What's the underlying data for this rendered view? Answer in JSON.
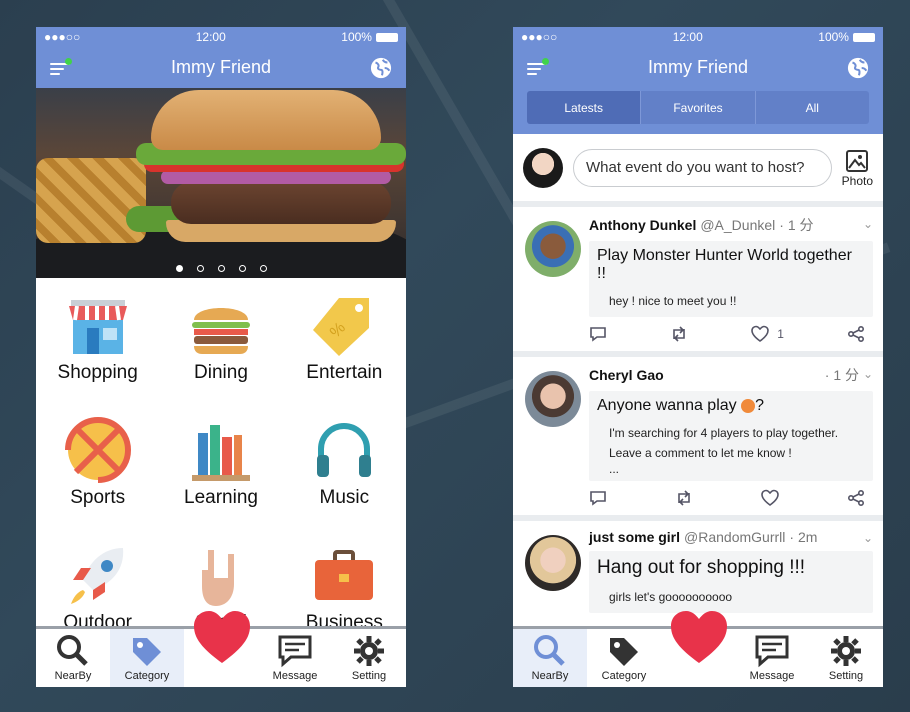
{
  "status": {
    "time": "12:00",
    "battery": "100%",
    "signal": "●●●○○"
  },
  "left": {
    "title": "Immy Friend",
    "carousel_dots": 5,
    "categories": [
      {
        "label": "Shopping",
        "icon": "shop-icon"
      },
      {
        "label": "Dining",
        "icon": "burger-icon"
      },
      {
        "label": "Entertain",
        "icon": "tag-icon"
      },
      {
        "label": "Sports",
        "icon": "ball-icon"
      },
      {
        "label": "Learning",
        "icon": "books-icon"
      },
      {
        "label": "Music",
        "icon": "headphones-icon"
      },
      {
        "label": "Outdoor",
        "icon": "rocket-icon"
      },
      {
        "label": "Social",
        "icon": "hand-icon"
      },
      {
        "label": "Business",
        "icon": "briefcase-icon"
      }
    ],
    "tabs": {
      "nearby": "NearBy",
      "category": "Category",
      "message": "Message",
      "setting": "Setting"
    }
  },
  "right": {
    "title": "Immy Friend",
    "segments": [
      "Latests",
      "Favorites",
      "All"
    ],
    "composer": {
      "placeholder": "What event do you want to host?",
      "photo_label": "Photo"
    },
    "posts": [
      {
        "name": "Anthony Dunkel",
        "handle": "@A_Dunkel",
        "time": "· 1 分",
        "headline": "Play Monster Hunter World together !!",
        "detail": "hey ! nice to meet you !!",
        "likes": "1"
      },
      {
        "name": "Cheryl Gao",
        "handle": "",
        "time": "· 1 分",
        "headline": "Anyone wanna play",
        "detail_1": "I'm searching for 4 players to play together.",
        "detail_2": "Leave a comment to let me know !",
        "detail_3": "...",
        "likes": ""
      },
      {
        "name": "just some girl",
        "handle": "@RandomGurrll",
        "time": "· 2m",
        "headline": "Hang out for shopping !!!",
        "detail": "girls let's goooooooooo",
        "likes": ""
      }
    ],
    "tabs": {
      "nearby": "NearBy",
      "category": "Category",
      "message": "Message",
      "setting": "Setting"
    }
  },
  "colors": {
    "brand": "#6f8fd6",
    "heart": "#e8334a",
    "active_segment": "#4f6cb6"
  }
}
